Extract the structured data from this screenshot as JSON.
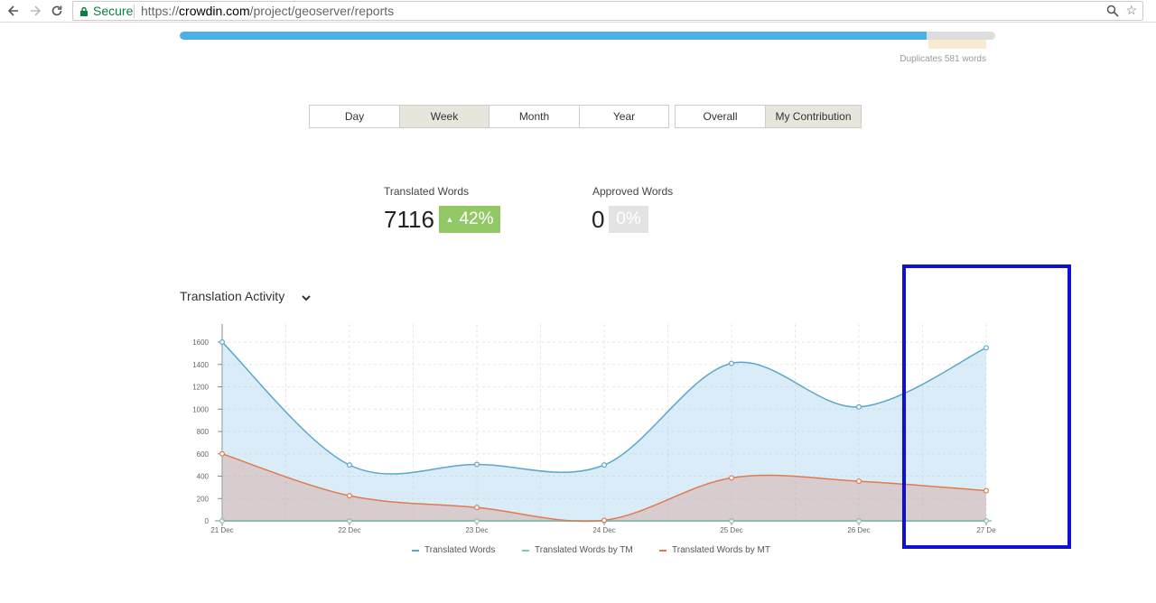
{
  "browser": {
    "secure_label": "Secure",
    "url_scheme": "https://",
    "url_host": "crowdin.com",
    "url_path": "/project/geoserver/reports"
  },
  "progress": {
    "fill_fraction": 0.916,
    "duplicates_text": "Duplicates 581 words"
  },
  "period_tabs": [
    "Day",
    "Week",
    "Month",
    "Year"
  ],
  "period_active": "Week",
  "scope_tabs": [
    "Overall",
    "My Contribution"
  ],
  "scope_active": "My Contribution",
  "stats": {
    "translated": {
      "label": "Translated Words",
      "value": "7116",
      "change": "42%"
    },
    "approved": {
      "label": "Approved Words",
      "value": "0",
      "change": "0%"
    }
  },
  "activity": {
    "title": "Translation Activity"
  },
  "colors": {
    "translated": "#5ba7c9",
    "tm": "#7cc7b4",
    "mt": "#e07b4f"
  },
  "chart_data": {
    "type": "area",
    "x": [
      "21 Dec",
      "22 Dec",
      "23 Dec",
      "24 Dec",
      "25 Dec",
      "26 Dec",
      "27 De"
    ],
    "ylim": [
      0,
      1600
    ],
    "yticks": [
      0,
      200,
      400,
      600,
      800,
      1000,
      1200,
      1400,
      1600
    ],
    "series": [
      {
        "name": "Translated Words",
        "values": [
          1600,
          500,
          505,
          500,
          1410,
          1020,
          1550
        ]
      },
      {
        "name": "Translated Words by TM",
        "values": [
          0,
          0,
          0,
          0,
          0,
          0,
          0
        ]
      },
      {
        "name": "Translated Words by MT",
        "values": [
          600,
          225,
          120,
          5,
          385,
          355,
          270
        ]
      }
    ],
    "legend_position": "bottom",
    "grid": true
  }
}
